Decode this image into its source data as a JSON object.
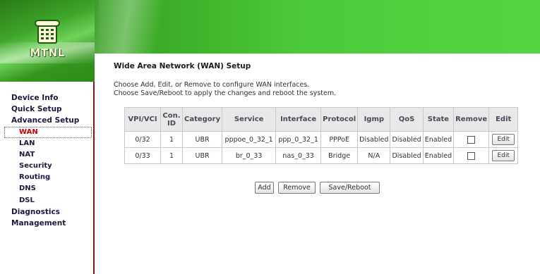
{
  "brand": {
    "name": "MTNL"
  },
  "nav": {
    "items": [
      {
        "label": "Device Info",
        "level": 0
      },
      {
        "label": "Quick Setup",
        "level": 0
      },
      {
        "label": "Advanced Setup",
        "level": 0
      },
      {
        "label": "WAN",
        "level": 1,
        "active": true
      },
      {
        "label": "LAN",
        "level": 1
      },
      {
        "label": "NAT",
        "level": 1
      },
      {
        "label": "Security",
        "level": 1
      },
      {
        "label": "Routing",
        "level": 1
      },
      {
        "label": "DNS",
        "level": 1
      },
      {
        "label": "DSL",
        "level": 1
      },
      {
        "label": "Diagnostics",
        "level": 0
      },
      {
        "label": "Management",
        "level": 0
      }
    ]
  },
  "page": {
    "title": "Wide Area Network (WAN) Setup",
    "desc_line1": "Choose Add, Edit, or Remove to configure WAN interfaces.",
    "desc_line2": "Choose Save/Reboot to apply the changes and reboot the system."
  },
  "table": {
    "headers": [
      "VPI/VCI",
      "Con. ID",
      "Category",
      "Service",
      "Interface",
      "Protocol",
      "Igmp",
      "QoS",
      "State",
      "Remove",
      "Edit"
    ],
    "rows": [
      {
        "vpi_vci": "0/32",
        "con_id": "1",
        "category": "UBR",
        "service": "pppoe_0_32_1",
        "interface": "ppp_0_32_1",
        "protocol": "PPPoE",
        "igmp": "Disabled",
        "qos": "Disabled",
        "state": "Enabled",
        "edit": "Edit"
      },
      {
        "vpi_vci": "0/33",
        "con_id": "1",
        "category": "UBR",
        "service": "br_0_33",
        "interface": "nas_0_33",
        "protocol": "Bridge",
        "igmp": "N/A",
        "qos": "Disabled",
        "state": "Enabled",
        "edit": "Edit"
      }
    ]
  },
  "buttons": {
    "add": "Add",
    "remove": "Remove",
    "save_reboot": "Save/Reboot"
  },
  "colors": {
    "banner_green": "#4cc93a",
    "nav_text": "#1a1a40",
    "nav_active": "#cc0000",
    "sidebar_border": "#7a1a1a"
  }
}
